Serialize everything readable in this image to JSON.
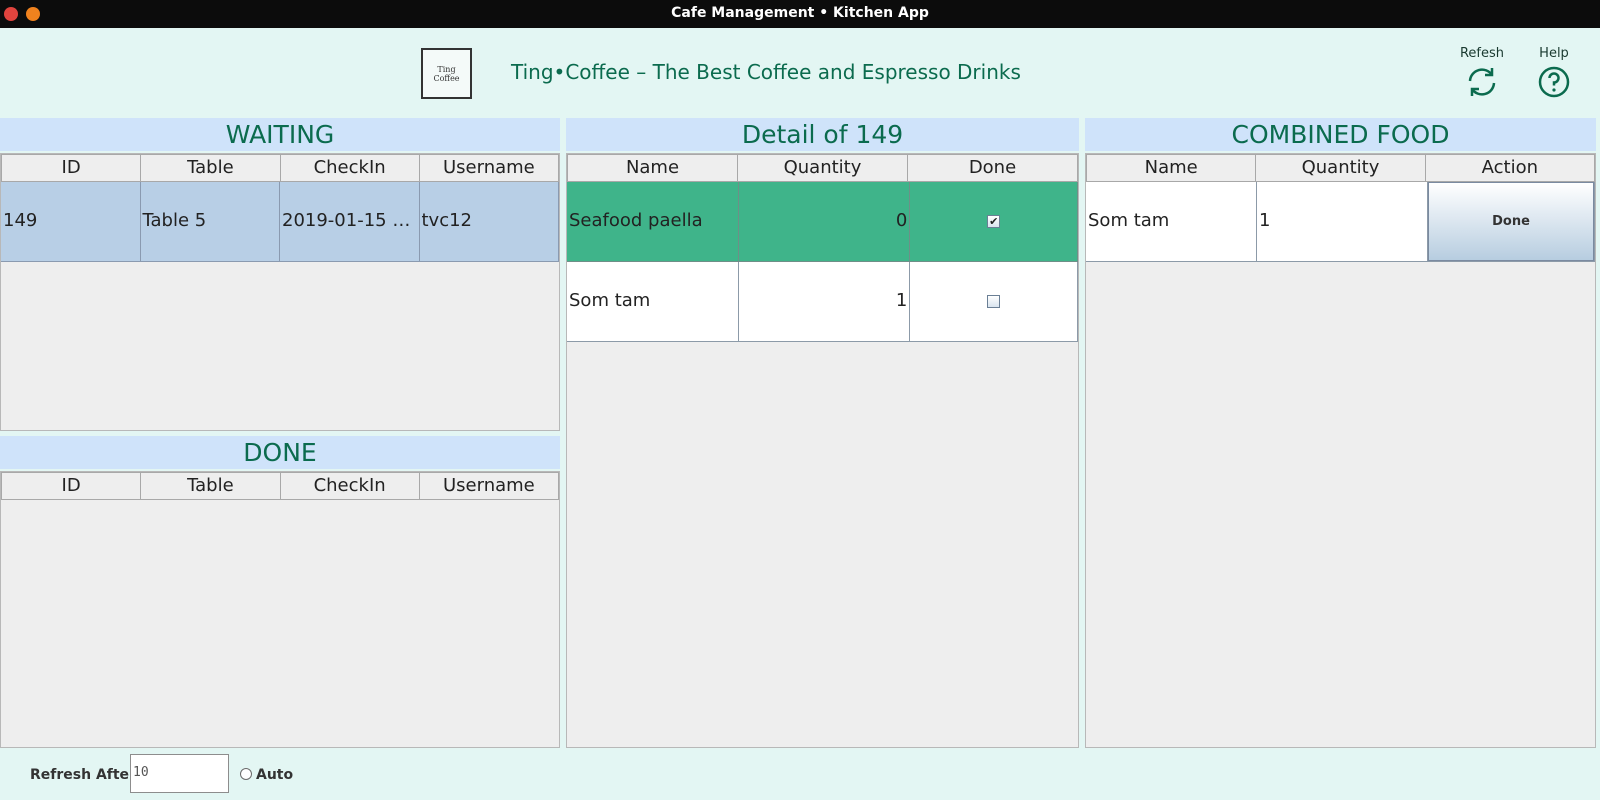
{
  "window": {
    "title": "Cafe Management • Kitchen App"
  },
  "header": {
    "logo_line1": "Ting",
    "logo_line2": "Coffee",
    "brand_text": "Ting•Coffee – The Best Coffee and Espresso Drinks",
    "refresh_label": "Refesh",
    "help_label": "Help"
  },
  "waiting": {
    "title": "WAITING",
    "columns": [
      "ID",
      "Table",
      "CheckIn",
      "Username"
    ],
    "rows": [
      {
        "id": "149",
        "table": "Table 5",
        "checkin": "2019-01-15 0...",
        "username": "tvc12"
      }
    ]
  },
  "done": {
    "title": "DONE",
    "columns": [
      "ID",
      "Table",
      "CheckIn",
      "Username"
    ]
  },
  "detail": {
    "title": "Detail of 149",
    "columns": [
      "Name",
      "Quantity",
      "Done"
    ],
    "rows": [
      {
        "name": "Seafood paella",
        "quantity": "0",
        "done": "✔"
      },
      {
        "name": "Som tam",
        "quantity": "1",
        "done": ""
      }
    ]
  },
  "combined": {
    "title": "COMBINED FOOD",
    "columns": [
      "Name",
      "Quantity",
      "Action"
    ],
    "rows": [
      {
        "name": "Som tam",
        "quantity": "1",
        "action": "Done"
      }
    ]
  },
  "footer": {
    "refresh_after_label": "Refresh After",
    "refresh_after_value": "10",
    "auto_label": "Auto"
  },
  "colors": {
    "accent": "#0b6b4e",
    "header_bg": "#cfe3fa",
    "selected_row": "#b8cfe6",
    "done_row": "#3fb48a",
    "background": "#e3f6f3"
  },
  "icons": [
    "refresh-icon",
    "help-icon",
    "checkbox-checked-icon",
    "checkbox-empty-icon",
    "radio-icon"
  ]
}
